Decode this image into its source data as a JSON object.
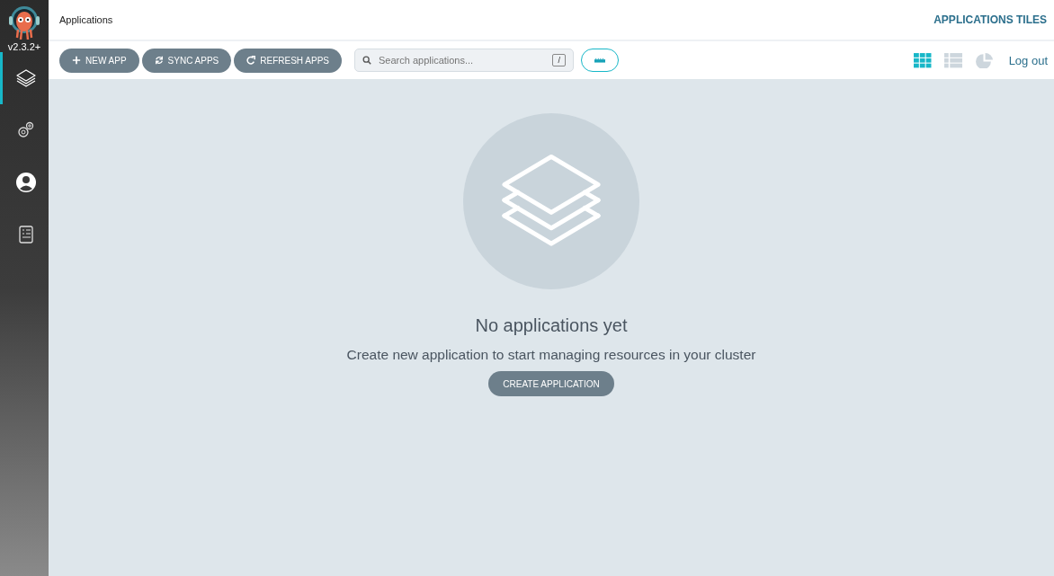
{
  "sidebar": {
    "version": "v2.3.2+",
    "items": [
      {
        "kind": "layers",
        "selected": true
      },
      {
        "kind": "gears",
        "selected": false
      },
      {
        "kind": "user",
        "selected": false
      },
      {
        "kind": "docs",
        "selected": false
      }
    ]
  },
  "header": {
    "title": "Applications",
    "view_title": "APPLICATIONS TILES"
  },
  "toolbar": {
    "buttons": [
      {
        "kind": "plus",
        "label": "NEW APP"
      },
      {
        "kind": "sync",
        "label": "SYNC APPS"
      },
      {
        "kind": "refresh",
        "label": "REFRESH APPS"
      }
    ],
    "search": {
      "placeholder": "Search applications...",
      "shortcut": "/"
    },
    "filter_toggle": {
      "on": false
    },
    "view_modes": [
      {
        "kind": "tiles",
        "selected": true
      },
      {
        "kind": "list",
        "selected": false
      },
      {
        "kind": "summary",
        "selected": false
      }
    ],
    "logout": "Log out"
  },
  "empty_state": {
    "heading": "No applications yet",
    "message": "Create new application to start managing resources in your cluster",
    "button": "CREATE APPLICATION"
  }
}
